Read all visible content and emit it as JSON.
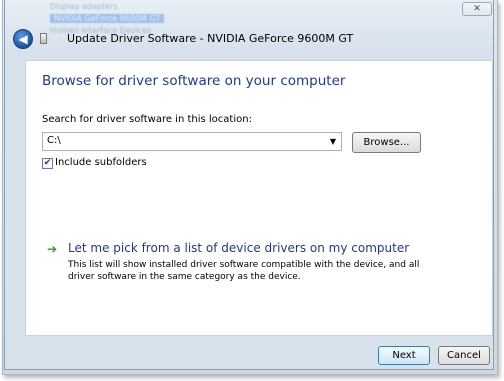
{
  "window": {
    "title": "Update Driver Software - NVIDIA GeForce 9600M GT",
    "close_glyph": "✕",
    "back_glyph": "◀"
  },
  "background_items": [
    "Display adapters",
    "NVIDIA GeForce 9600M GT",
    "Human Interface Devices"
  ],
  "main": {
    "heading": "Browse for driver software on your computer",
    "location_label": "Search for driver software in this location:",
    "location_value": "C:\\",
    "dropdown_glyph": "▼",
    "browse_label": "Browse...",
    "include_subfolders": {
      "label": "Include subfolders",
      "checked": true,
      "check_glyph": "✔"
    },
    "pick_option": {
      "arrow_glyph": "➔",
      "title": "Let me pick from a list of device drivers on my computer",
      "description": "This list will show installed driver software compatible with the device, and all driver software in the same category as the device."
    }
  },
  "footer": {
    "next_label": "Next",
    "cancel_label": "Cancel"
  },
  "colors": {
    "heading": "#1f3a93",
    "arrow": "#2d9b2d",
    "frame": "#d8e2ed"
  }
}
